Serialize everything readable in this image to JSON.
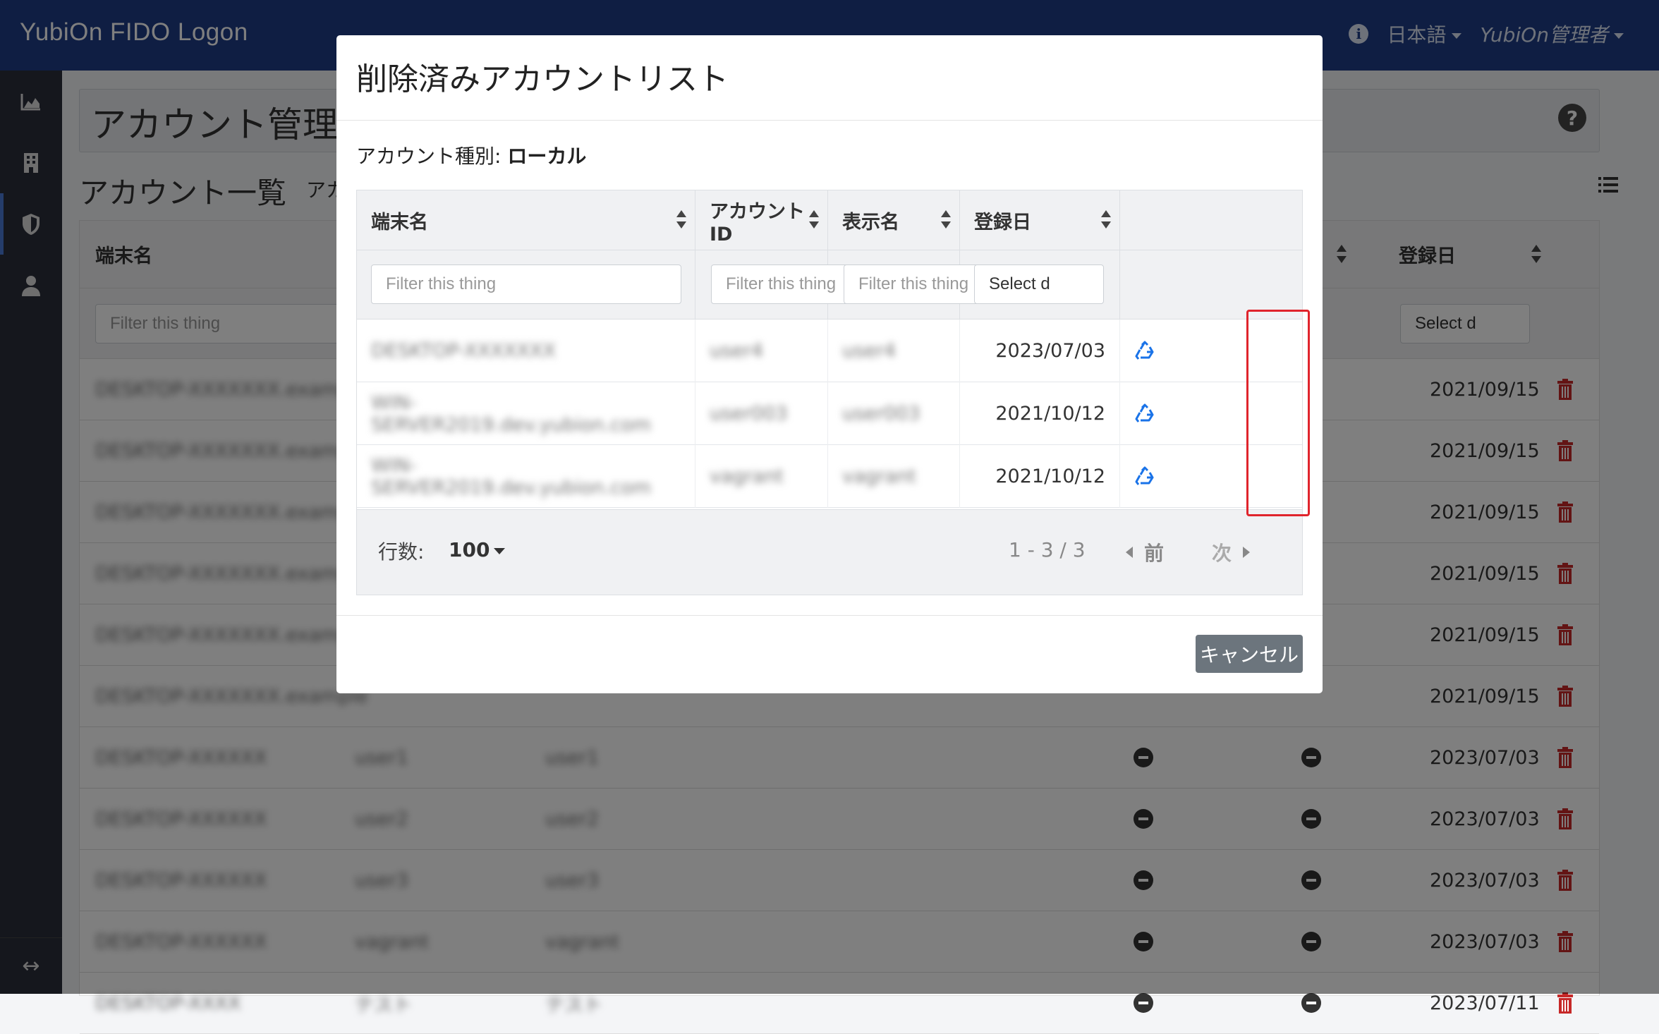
{
  "app": {
    "brand": "YubiOn FIDO Logon",
    "language": "日本語",
    "user": "YubiOn管理者"
  },
  "page": {
    "title": "アカウント管理",
    "list_title": "アカウント一覧",
    "list_sub": "アカ",
    "bg_columns": {
      "terminal": "端末名",
      "registered": "登録日"
    },
    "bg_filter_placeholder": "Filter this thing",
    "bg_date_filter": "Select d",
    "bg_rows": [
      {
        "terminal": "DESKTOP-XXXXXXX.example",
        "id": "",
        "name": "",
        "date": "2021/09/15",
        "flag1": false,
        "flag2": false
      },
      {
        "terminal": "DESKTOP-XXXXXXX.example",
        "id": "",
        "name": "",
        "date": "2021/09/15",
        "flag1": false,
        "flag2": false
      },
      {
        "terminal": "DESKTOP-XXXXXXX.example",
        "id": "",
        "name": "",
        "date": "2021/09/15",
        "flag1": false,
        "flag2": false
      },
      {
        "terminal": "DESKTOP-XXXXXXX.example",
        "id": "",
        "name": "",
        "date": "2021/09/15",
        "flag1": false,
        "flag2": false
      },
      {
        "terminal": "DESKTOP-XXXXXXX.example",
        "id": "",
        "name": "",
        "date": "2021/09/15",
        "flag1": false,
        "flag2": false
      },
      {
        "terminal": "DESKTOP-XXXXXXX.example",
        "id": "",
        "name": "",
        "date": "2021/09/15",
        "flag1": false,
        "flag2": false
      },
      {
        "terminal": "DESKTOP-XXXXXX",
        "id": "user1",
        "name": "user1",
        "date": "2023/07/03",
        "flag1": true,
        "flag2": true
      },
      {
        "terminal": "DESKTOP-XXXXXX",
        "id": "user2",
        "name": "user2",
        "date": "2023/07/03",
        "flag1": true,
        "flag2": true
      },
      {
        "terminal": "DESKTOP-XXXXXX",
        "id": "user3",
        "name": "user3",
        "date": "2023/07/03",
        "flag1": true,
        "flag2": true
      },
      {
        "terminal": "DESKTOP-XXXXXX",
        "id": "vagrant",
        "name": "vagrant",
        "date": "2023/07/03",
        "flag1": true,
        "flag2": true
      },
      {
        "terminal": "DESKTOP-XXXX",
        "id": "テスト",
        "name": "テスト",
        "date": "2023/07/11",
        "flag1": true,
        "flag2": true
      }
    ]
  },
  "modal": {
    "title": "削除済みアカウントリスト",
    "account_type_label": "アカウント種別:",
    "account_type_value": "ローカル",
    "columns": {
      "terminal": "端末名",
      "account_id": "アカウントID",
      "display_name": "表示名",
      "registered": "登録日"
    },
    "filter_placeholder": "Filter this thing",
    "date_filter": "Select d",
    "rows": [
      {
        "terminal": "DESKTOP-XXXXXXX",
        "account_id": "user4",
        "display_name": "user4",
        "registered": "2023/07/03"
      },
      {
        "terminal": "WIN-SERVER2019.dev.yubion.com",
        "account_id": "user003",
        "display_name": "user003",
        "registered": "2021/10/12"
      },
      {
        "terminal": "WIN-SERVER2019.dev.yubion.com",
        "account_id": "vagrant",
        "display_name": "vagrant",
        "registered": "2021/10/12"
      }
    ],
    "footer": {
      "rows_label": "行数:",
      "rows_value": "100",
      "range": "1 - 3 / 3",
      "prev": "前",
      "next": "次"
    },
    "cancel": "キャンセル"
  },
  "colors": {
    "topbar": "#1f3d87",
    "sidebar": "#2a2e3a",
    "restore_icon": "#1a73e8",
    "trash_icon": "#c62828",
    "highlight": "#e0242c",
    "cancel_button": "#6c757d"
  },
  "icons": {
    "sidebar": [
      "chart-area-icon",
      "building-icon",
      "shield-icon",
      "user-icon"
    ],
    "restore": "recycle-icon",
    "delete": "trash-icon"
  }
}
